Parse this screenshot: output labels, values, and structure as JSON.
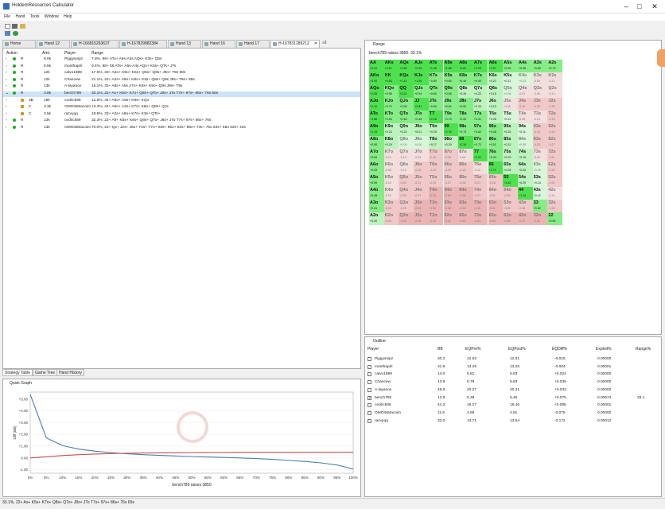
{
  "app": {
    "title": "HoldemResources Calculator",
    "menu": [
      "File",
      "Hand",
      "Tools",
      "Window",
      "Help"
    ],
    "win_min": "–",
    "win_max": "□",
    "win_close": "✕"
  },
  "tabs": [
    "Home",
    "Hand 12",
    "H-166815263637",
    "H-167829882384",
    "Hand 13",
    "Hand 16",
    "Hand 17",
    "H-167831289212"
  ],
  "tab_close": "✕",
  "tab_more": "»2",
  "strategy": {
    "headers": [
      "Action",
      "Amt.",
      "Player",
      "Range"
    ],
    "rows": [
      {
        "tree": "›",
        "icon": "dot",
        "action": "R",
        "amt": "9.0k",
        "player": "Piggysnipz",
        "range": "7.8%, 99+ ATo+ A5s-A3s AQs+ K3s+ Q5s"
      },
      {
        "tree": "›",
        "icon": "dot",
        "action": "R",
        "amt": "9.5k",
        "player": "monthapril",
        "range": "9.4%, 88+ 66 ATo+ A5s-A4s AQs+ K5s+ QTs+ JTs"
      },
      {
        "tree": "›",
        "icon": "dot",
        "action": "R",
        "amt": "12k",
        "player": "calvo1989",
        "range": "17.5%, 33+ A3o+ K9o+ K6s+ Q9o+ Q9s+ J9o+ T9s 98s"
      },
      {
        "tree": "›",
        "icon": "dot",
        "action": "R",
        "amt": "12k",
        "player": "Chancew",
        "range": "21.1%, 22+ A2s+ A9o+ K8o+ K3s+ Q8s+ Q9s J8s+ T8s+ 98s"
      },
      {
        "tree": "›",
        "icon": "dot",
        "action": "R",
        "amt": "13k",
        "player": "A-layanox",
        "range": "15.1%, 33+ A8s+ A5s A7o+ K9s+ K9o+ Q9s J9s+ T9s"
      },
      {
        "tree": "⌄",
        "icon": "dot",
        "action": "R",
        "amt": "3.8k",
        "player": "bench789",
        "range": "33.1%, 22+ Ax+ K5s+ K7o+ Q8s+ QTo+ J8s+ JTo T7s+ 97s+ 86s+ 76s 65s",
        "selected": true
      },
      {
        "tree": "›",
        "icon": "lock",
        "action": "3B",
        "amt": "19k",
        "player": "cedrick89",
        "range": "12.8%, 44+ A9o+ A9s+ K9s+ KQo"
      },
      {
        "tree": "›",
        "icon": "lock",
        "action": "C",
        "amt": "3.3k",
        "player": "OMGitsMacoim",
        "range": "13.3%, 44+ A5o+ A2s+ K7s+ K8o+ Q8s+ QJs"
      },
      {
        "tree": "›",
        "icon": "lock",
        "action": "C",
        "amt": "3.5k",
        "player": "razvyqq",
        "range": "19.6%, 33+ A2s+ A8o+ K7s+ K3s+ QTs+"
      },
      {
        "tree": "›",
        "icon": "dot",
        "action": "R",
        "amt": "13k",
        "player": "cedrick89",
        "range": "32.3%, 22+ A9+ K5s+ K9o+ Q8s+ QTo+ J8s+ JTo T7s+ 97s+ 86s+ 76s"
      },
      {
        "tree": "›",
        "icon": "dot",
        "action": "R",
        "amt": "13k",
        "player": "OMGitsMacoim",
        "range": "70.0%, 22+ Qx+ J2s+ J6o+ T2s+ T7o+ 93s+ 96o+ 84s+ 86o+ 74s+ 76o 63s+ 65o 53s+ 43s"
      }
    ]
  },
  "bottom_tabs": [
    "Strategy Table",
    "Game Tree",
    "Hand History"
  ],
  "quick_graph": {
    "title": "Quick Graph",
    "xlabel": "bench789 raises 3850",
    "ylabel": "Diff (BB)"
  },
  "chart_data": {
    "type": "line",
    "x": [
      0,
      5,
      10,
      15,
      20,
      25,
      30,
      35,
      40,
      45,
      50,
      55,
      60,
      65,
      70,
      75,
      80,
      85,
      90,
      95,
      100
    ],
    "xticks": [
      "0%",
      "5%",
      "10%",
      "15%",
      "20%",
      "25%",
      "30%",
      "35%",
      "40%",
      "45%",
      "50%",
      "55%",
      "60%",
      "65%",
      "70%",
      "75%",
      "80%",
      "85%",
      "90%",
      "95%",
      "100%"
    ],
    "yticks": [
      "+5.00",
      "+4.00",
      "+3.00",
      "+2.00",
      "+1.00",
      "0.00",
      "-1.00"
    ],
    "ylim": [
      -1.3,
      5.6
    ],
    "series": [
      {
        "color": "#4a7fa8",
        "values": [
          5.4,
          1.7,
          1.05,
          0.75,
          0.58,
          0.45,
          0.35,
          0.28,
          0.22,
          0.17,
          0.12,
          0.08,
          0.04,
          0.0,
          -0.05,
          -0.12,
          -0.2,
          -0.3,
          -0.42,
          -0.6,
          -0.95
        ]
      },
      {
        "color": "#c0504d",
        "values": [
          0.0,
          0.1,
          0.2,
          0.28,
          0.33,
          0.37,
          0.4,
          0.42,
          0.43,
          0.44,
          0.45,
          0.46,
          0.46,
          0.47,
          0.47,
          0.47,
          0.47,
          0.48,
          0.48,
          0.48,
          0.48
        ]
      }
    ]
  },
  "range": {
    "title": "Range",
    "subtitle": "bench789 raises 3850: 33.1%",
    "labels": [
      [
        "AA",
        "AKs",
        "AQs",
        "AJs",
        "ATs",
        "A9s",
        "A8s",
        "A7s",
        "A6s",
        "A5s",
        "A4s",
        "A3s",
        "A2s"
      ],
      [
        "AKo",
        "KK",
        "KQs",
        "KJs",
        "KTs",
        "K9s",
        "K8s",
        "K7s",
        "K6s",
        "K5s",
        "K4s",
        "K3s",
        "K2s"
      ],
      [
        "AQo",
        "KQo",
        "QQ",
        "QJs",
        "QTs",
        "Q9s",
        "Q8s",
        "Q7s",
        "Q6s",
        "Q5s",
        "Q4s",
        "Q3s",
        "Q2s"
      ],
      [
        "AJo",
        "KJo",
        "QJo",
        "JJ",
        "JTs",
        "J9s",
        "J8s",
        "J7s",
        "J6s",
        "J5s",
        "J4s",
        "J3s",
        "J2s"
      ],
      [
        "ATo",
        "KTo",
        "QTo",
        "JTo",
        "TT",
        "T9s",
        "T8s",
        "T7s",
        "T6s",
        "T5s",
        "T4s",
        "T3s",
        "T2s"
      ],
      [
        "A9o",
        "K9o",
        "Q9o",
        "J9o",
        "T9o",
        "99",
        "98s",
        "97s",
        "96s",
        "95s",
        "94s",
        "93s",
        "92s"
      ],
      [
        "A8o",
        "K8o",
        "Q8o",
        "J8o",
        "T8o",
        "98o",
        "88",
        "87s",
        "86s",
        "85s",
        "84s",
        "83s",
        "82s"
      ],
      [
        "A7o",
        "K7o",
        "Q7o",
        "J7o",
        "T7o",
        "97o",
        "87o",
        "77",
        "76s",
        "75s",
        "74s",
        "73s",
        "72s"
      ],
      [
        "A6o",
        "K6o",
        "Q6o",
        "J6o",
        "T6o",
        "96o",
        "86o",
        "76o",
        "66",
        "65s",
        "64s",
        "63s",
        "62s"
      ],
      [
        "A5o",
        "K5o",
        "Q5o",
        "J5o",
        "T5o",
        "95o",
        "85o",
        "75o",
        "65o",
        "55",
        "54s",
        "53s",
        "52s"
      ],
      [
        "A4o",
        "K4o",
        "Q4o",
        "J4o",
        "T4o",
        "94o",
        "84o",
        "74o",
        "64o",
        "54o",
        "44",
        "43s",
        "42s"
      ],
      [
        "A3o",
        "K3o",
        "Q3o",
        "J3o",
        "T3o",
        "93o",
        "83o",
        "73o",
        "63o",
        "53o",
        "43o",
        "33",
        "32s"
      ],
      [
        "A2o",
        "K2o",
        "Q2o",
        "J2o",
        "T2o",
        "92o",
        "82o",
        "72o",
        "62o",
        "52o",
        "42o",
        "32o",
        "22"
      ]
    ],
    "values": [
      [
        "+5.51",
        "+3.21",
        "+2.69",
        "+2.25",
        "+1.95",
        "+1.89",
        "+1.61",
        "+1.25",
        "+1.07",
        "+0.95",
        "+0.96",
        "+0.80",
        "+0.73"
      ],
      [
        "+3.00",
        "+4.63",
        "+1.41",
        "+1.09",
        "+0.89",
        "+0.64",
        "+0.49",
        "+0.40",
        "+0.23",
        "+0.11",
        "+0.03",
        "-0.05",
        "-0.12"
      ],
      [
        "+2.55",
        "+0.96",
        "+3.21",
        "+0.94",
        "+0.80",
        "+0.58",
        "+0.39",
        "+0.22",
        "+0.15",
        "+0.08",
        "-0.01",
        "-0.06",
        "-0.13"
      ],
      [
        "+2.12",
        "+0.70",
        "+0.56",
        "+2.81",
        "+0.80",
        "+0.54",
        "+0.52",
        "+0.33",
        "+0.15",
        "-0.08",
        "-0.15",
        "-0.20",
        "-0.25"
      ],
      [
        "+1.66",
        "+0.50",
        "+0.48",
        "+0.45",
        "+2.16",
        "+0.74",
        "+0.59",
        "+0.41",
        "+0.28",
        "+0.12",
        "-0.05",
        "-0.14",
        "-0.22"
      ],
      [
        "+1.19",
        "+0.23",
        "+0.22",
        "+0.21",
        "+0.25",
        "+2.76",
        "+0.73",
        "+0.62",
        "+0.48",
        "+0.25",
        "+0.11",
        "-0.18",
        "-0.24"
      ],
      [
        "+0.90",
        "+0.20",
        "+0.09",
        "+0.00",
        "+0.17",
        "+0.29",
        "+2.34",
        "+0.72",
        "+0.51",
        "+0.31",
        "+0.08",
        "-0.20",
        "-0.27"
      ],
      [
        "+0.69",
        "-0.12",
        "-0.13",
        "-0.03",
        "-0.15",
        "-0.18",
        "-0.06",
        "+2.01",
        "+0.44",
        "+0.29",
        "+0.15",
        "-0.03",
        "-0.21"
      ],
      [
        "+0.53",
        "-0.08",
        "-0.13",
        "-0.16",
        "-0.24",
        "-0.20",
        "-0.15",
        "-0.12",
        "+1.71",
        "+0.26",
        "+0.30",
        "+0.06",
        "-0.23"
      ],
      [
        "+0.59",
        "-0.13",
        "-0.20",
        "-0.21",
        "-0.25",
        "-0.27",
        "-0.28",
        "-0.21",
        "-0.18",
        "+1.42",
        "+0.29",
        "+0.14",
        "-0.21"
      ],
      [
        "+0.48",
        "-0.13",
        "-0.23",
        "-0.27",
        "-0.32",
        "-0.39",
        "-0.38",
        "-0.27",
        "-0.21",
        "-0.20",
        "+1.14",
        "+0.12",
        "-0.14"
      ],
      [
        "+0.41",
        "-0.23",
        "-0.29",
        "-0.30",
        "-0.36",
        "-0.38",
        "-0.36",
        "-0.35",
        "-0.31",
        "-0.26",
        "-0.28",
        "+0.92",
        "-0.22"
      ],
      [
        "+0.20",
        "-0.24",
        "-0.33",
        "-0.36",
        "-0.40",
        "-0.42",
        "-0.43",
        "-0.43",
        "-0.38",
        "-0.36",
        "-0.37",
        "-0.41",
        "+0.60"
      ]
    ]
  },
  "outline": {
    "title": "Outline",
    "headers": [
      "Player",
      "BB",
      "EQPre%",
      "EQPost%",
      "EQDiff%",
      "Exploit%",
      "Range%"
    ],
    "rows": [
      {
        "player": "Piggysnipz",
        "bb": "30.2",
        "eqpre": "12.53",
        "eqpost": "12.51",
        "eqdiff": "-0.015",
        "exploit": "0.00000",
        "range": "",
        "checked": false
      },
      {
        "player": "monthapril",
        "bb": "31.8",
        "eqpre": "13.26",
        "eqpost": "13.25",
        "eqdiff": "-0.004",
        "exploit": "0.00001",
        "range": "",
        "checked": false
      },
      {
        "player": "calvo1989",
        "bb": "14.0",
        "eqpre": "5.81",
        "eqpost": "5.83",
        "eqdiff": "+0.024",
        "exploit": "0.00000",
        "range": "",
        "checked": false
      },
      {
        "player": "Chancew",
        "bb": "13.9",
        "eqpre": "5.79",
        "eqpost": "5.83",
        "eqdiff": "+0.039",
        "exploit": "0.00000",
        "range": "",
        "checked": false
      },
      {
        "player": "A-layanox",
        "bb": "48.8",
        "eqpre": "20.27",
        "eqpost": "20.31",
        "eqdiff": "+0.033",
        "exploit": "0.00002",
        "range": "",
        "checked": false
      },
      {
        "player": "bench789",
        "bb": "12.9",
        "eqpre": "5.38",
        "eqpost": "5.46",
        "eqdiff": "+0.075",
        "exploit": "0.00574",
        "range": "33.1",
        "checked": true
      },
      {
        "player": "cedrick89",
        "bb": "44.2",
        "eqpre": "18.27",
        "eqpost": "18.46",
        "eqdiff": "+0.095",
        "exploit": "0.00001",
        "range": "",
        "checked": false
      },
      {
        "player": "OMGitsMacoim",
        "bb": "11.6",
        "eqpre": "4.88",
        "eqpost": "4.81",
        "eqdiff": "-0.075",
        "exploit": "0.00000",
        "range": "",
        "checked": false
      },
      {
        "player": "razvyqq",
        "bb": "33.0",
        "eqpre": "13.71",
        "eqpost": "13.54",
        "eqdiff": "-0.172",
        "exploit": "0.00012",
        "range": "",
        "checked": false
      }
    ]
  },
  "status_text": "33.1%, 22+ Ax+ K5s+ K7o+ Q8s+ QTo+ J8s+ JTo T7s+ 97s+ 86s+ 76s 65s"
}
